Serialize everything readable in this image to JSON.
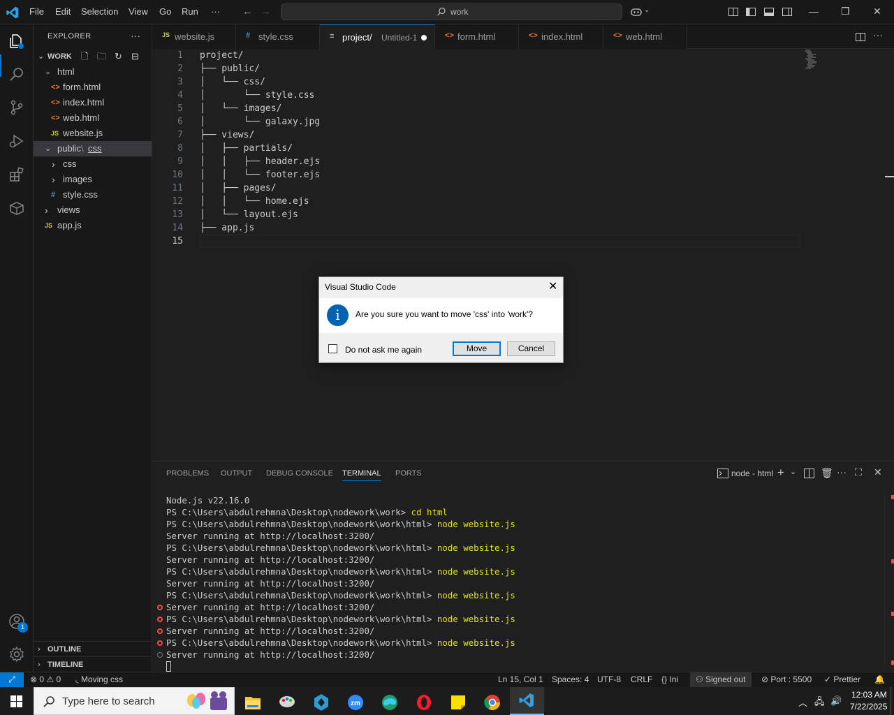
{
  "titlebar": {
    "menu": [
      "File",
      "Edit",
      "Selection",
      "View",
      "Go",
      "Run",
      "···"
    ],
    "search_text": "work"
  },
  "explorer": {
    "title": "EXPLORER",
    "root": "WORK",
    "tree": [
      {
        "label": "html",
        "type": "folder-open",
        "indent": 1
      },
      {
        "label": "form.html",
        "type": "html",
        "indent": 2
      },
      {
        "label": "index.html",
        "type": "html",
        "indent": 2
      },
      {
        "label": "web.html",
        "type": "html",
        "indent": 2
      },
      {
        "label": "website.js",
        "type": "js",
        "indent": 2
      },
      {
        "label": "public",
        "label_b": "css",
        "type": "folder-open-compact",
        "indent": 1
      },
      {
        "label": "css",
        "type": "folder",
        "indent": 2
      },
      {
        "label": "images",
        "type": "folder",
        "indent": 2
      },
      {
        "label": "style.css",
        "type": "css",
        "indent": 2
      },
      {
        "label": "views",
        "type": "folder",
        "indent": 1
      },
      {
        "label": "app.js",
        "type": "js",
        "indent": 1
      }
    ],
    "outline": "OUTLINE",
    "timeline": "TIMELINE"
  },
  "tabs": [
    {
      "icon": "JS",
      "label": "website.js",
      "kind": "js"
    },
    {
      "icon": "#",
      "label": "style.css",
      "kind": "css"
    },
    {
      "icon": "≡",
      "label": "project/",
      "sub": "Untitled-1",
      "kind": "txt",
      "active": true,
      "dirty": true
    },
    {
      "icon": "<>",
      "label": "form.html",
      "kind": "html"
    },
    {
      "icon": "<>",
      "label": "index.html",
      "kind": "html"
    },
    {
      "icon": "<>",
      "label": "web.html",
      "kind": "html"
    }
  ],
  "editor": {
    "lines": [
      "project/",
      "├── public/",
      "│   └── css/",
      "│       └── style.css",
      "│   └── images/",
      "│       └── galaxy.jpg",
      "├── views/",
      "│   ├── partials/",
      "│   │   ├── header.ejs",
      "│   │   └── footer.ejs",
      "│   ├── pages/",
      "│   │   └── home.ejs",
      "│   └── layout.ejs",
      "├── app.js",
      ""
    ],
    "line_numbers": [
      "1",
      "2",
      "3",
      "4",
      "5",
      "6",
      "7",
      "8",
      "9",
      "10",
      "11",
      "12",
      "13",
      "14",
      "15"
    ],
    "current_line": 15
  },
  "dialog": {
    "title": "Visual Studio Code",
    "message": "Are you sure you want to move 'css' into 'work'?",
    "checkbox_label": "Do not ask me again",
    "move_label": "Move",
    "cancel_label": "Cancel"
  },
  "panel": {
    "tabs": [
      "PROBLEMS",
      "OUTPUT",
      "DEBUG CONSOLE",
      "TERMINAL",
      "PORTS"
    ],
    "active_tab": "TERMINAL",
    "terminal_name": "node - html",
    "terminal": [
      {
        "text": "Node.js v22.16.0",
        "cmd": "",
        "mark": "none"
      },
      {
        "text": "PS C:\\Users\\abdulrehmna\\Desktop\\nodework\\work> ",
        "cmd": "cd html",
        "mark": "none"
      },
      {
        "text": "PS C:\\Users\\abdulrehmna\\Desktop\\nodework\\work\\html> ",
        "cmd": "node website.js",
        "mark": "none"
      },
      {
        "text": "Server running at http://localhost:3200/",
        "cmd": "",
        "mark": "none"
      },
      {
        "text": "PS C:\\Users\\abdulrehmna\\Desktop\\nodework\\work\\html> ",
        "cmd": "node website.js",
        "mark": "none"
      },
      {
        "text": "Server running at http://localhost:3200/",
        "cmd": "",
        "mark": "none"
      },
      {
        "text": "PS C:\\Users\\abdulrehmna\\Desktop\\nodework\\work\\html> ",
        "cmd": "node website.js",
        "mark": "none"
      },
      {
        "text": "Server running at http://localhost:3200/",
        "cmd": "",
        "mark": "none"
      },
      {
        "text": "PS C:\\Users\\abdulrehmna\\Desktop\\nodework\\work\\html> ",
        "cmd": "node website.js",
        "mark": "none"
      },
      {
        "text": "Server running at http://localhost:3200/",
        "cmd": "",
        "mark": "err"
      },
      {
        "text": "PS C:\\Users\\abdulrehmna\\Desktop\\nodework\\work\\html> ",
        "cmd": "node website.js",
        "mark": "err"
      },
      {
        "text": "Server running at http://localhost:3200/",
        "cmd": "",
        "mark": "err"
      },
      {
        "text": "PS C:\\Users\\abdulrehmna\\Desktop\\nodework\\work\\html> ",
        "cmd": "node website.js",
        "mark": "err"
      },
      {
        "text": "Server running at http://localhost:3200/",
        "cmd": "",
        "mark": "ok"
      }
    ]
  },
  "statusbar": {
    "errors": "0",
    "warnings": "0",
    "activity": "Moving css",
    "position": "Ln 15, Col 1",
    "spaces": "Spaces: 4",
    "encoding": "UTF-8",
    "eol": "CRLF",
    "language": "Ini",
    "account": "Signed out",
    "port": "Port : 5500",
    "prettier": "Prettier"
  },
  "taskbar": {
    "search_placeholder": "Type here to search",
    "time": "12:03 AM",
    "date": "7/22/2025"
  },
  "colors": {
    "accent": "#0078d4",
    "error": "#f14c4c",
    "html_icon": "#e37933",
    "js_icon": "#cbcb41",
    "css_icon": "#519aba"
  }
}
